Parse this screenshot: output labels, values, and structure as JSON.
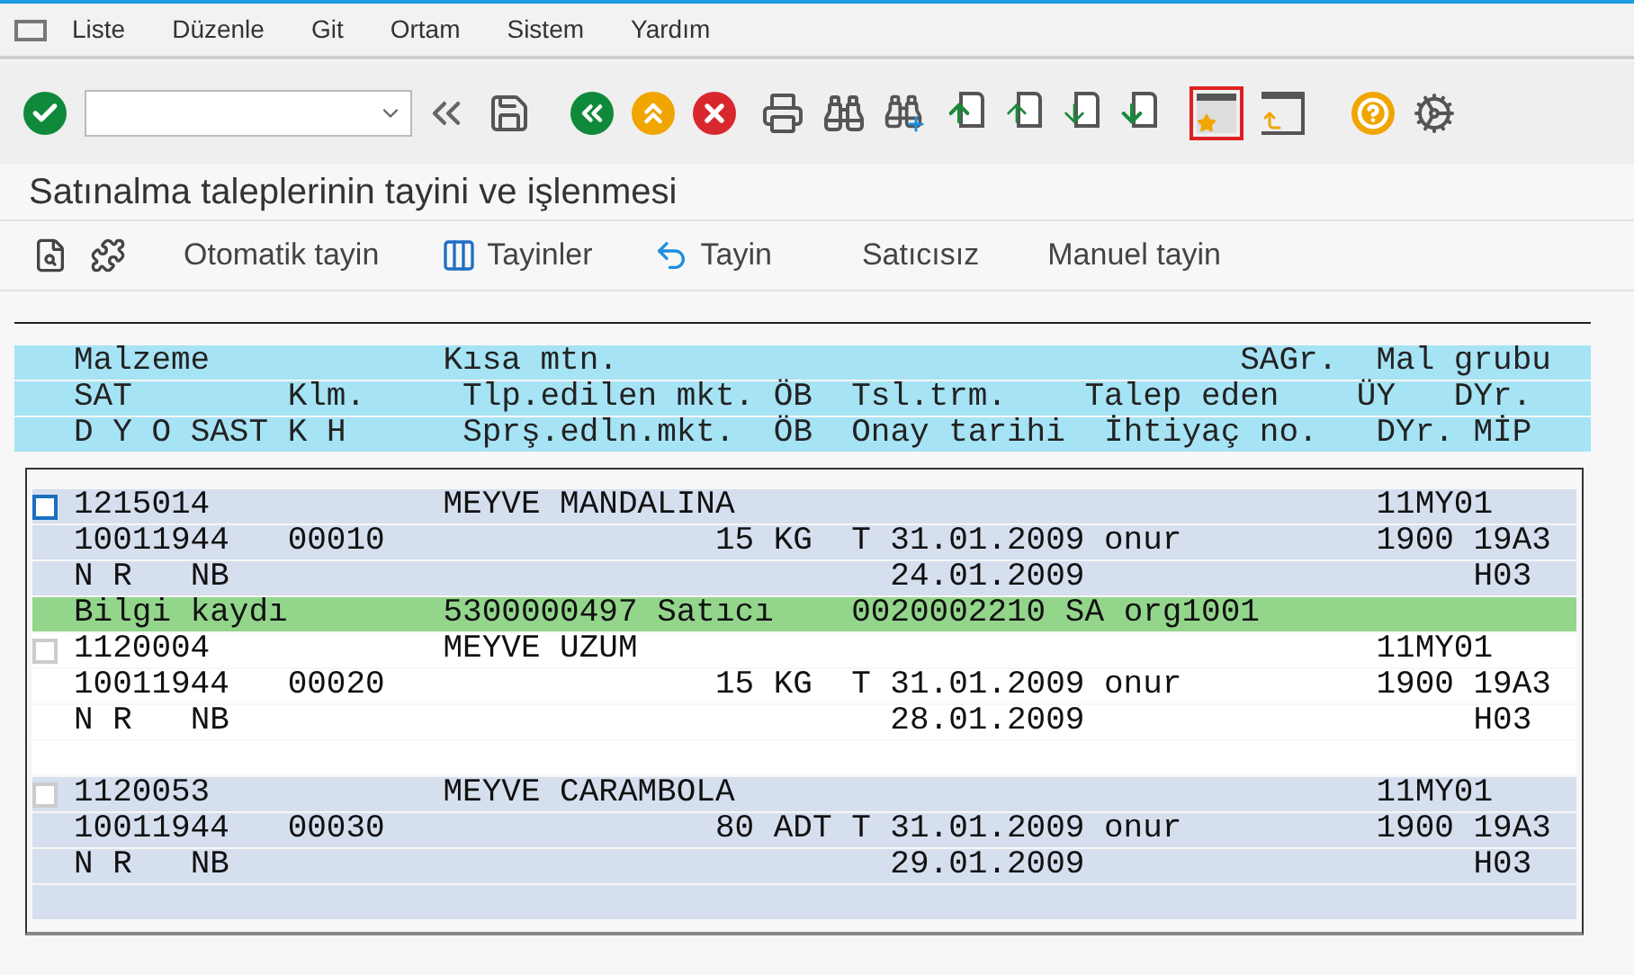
{
  "menu": [
    "Liste",
    "Düzenle",
    "Git",
    "Ortam",
    "Sistem",
    "Yardım"
  ],
  "title": "Satınalma taleplerinin tayini ve işlenmesi",
  "app_toolbar": [
    {
      "label": "Otomatik tayin"
    },
    {
      "label": "Tayinler"
    },
    {
      "label": "Tayin"
    },
    {
      "label": "Satıcısız"
    },
    {
      "label": "Manuel tayin"
    }
  ],
  "header_lines": [
    [
      "Malzeme",
      "Kısa mtn.",
      "SAGr.",
      "Mal grubu"
    ],
    [
      "SAT",
      "Klm.",
      "Tlp.edilen mkt.",
      "ÖB",
      "Tsl.trm.",
      "Talep eden",
      "ÜY",
      "DYr."
    ],
    [
      "D",
      "Y",
      "O",
      "SAST",
      "K",
      "H",
      "Sprş.edln.mkt.",
      "ÖB",
      "Onay tarihi",
      "İhtiyaç no.",
      "DYr.",
      "MİP"
    ]
  ],
  "items": [
    {
      "checked": false,
      "focused": true,
      "line_1": [
        "1215014",
        "MEYVE MANDALINA",
        "11MY01"
      ],
      "line_2": [
        "10011944",
        "00010",
        "15",
        "KG",
        "T",
        "31.01.2009",
        "onur",
        "1900",
        "19A3"
      ],
      "line_3": [
        "N",
        "R",
        "NB",
        "24.01.2009",
        "H03"
      ],
      "extra": {
        "kind": "info",
        "cells": [
          "Bilgi kaydı",
          "5300000497",
          "Satıcı",
          "0020002210",
          "SA",
          "org1001"
        ]
      }
    },
    {
      "checked": false,
      "focused": false,
      "line_1": [
        "1120004",
        "MEYVE UZUM",
        "11MY01"
      ],
      "line_2": [
        "10011944",
        "00020",
        "15",
        "KG",
        "T",
        "31.01.2009",
        "onur",
        "1900",
        "19A3"
      ],
      "line_3": [
        "N",
        "R",
        "NB",
        "28.01.2009",
        "H03"
      ],
      "extra": {
        "kind": "blank"
      }
    },
    {
      "checked": false,
      "focused": false,
      "line_1": [
        "1120053",
        "MEYVE CARAMBOLA",
        "11MY01"
      ],
      "line_2": [
        "10011944",
        "00030",
        "80",
        "ADT",
        "T",
        "31.01.2009",
        "onur",
        "1900",
        "19A3"
      ],
      "line_3": [
        "N",
        "R",
        "NB",
        "29.01.2009",
        "H03"
      ],
      "extra": {
        "kind": "blank"
      }
    }
  ]
}
